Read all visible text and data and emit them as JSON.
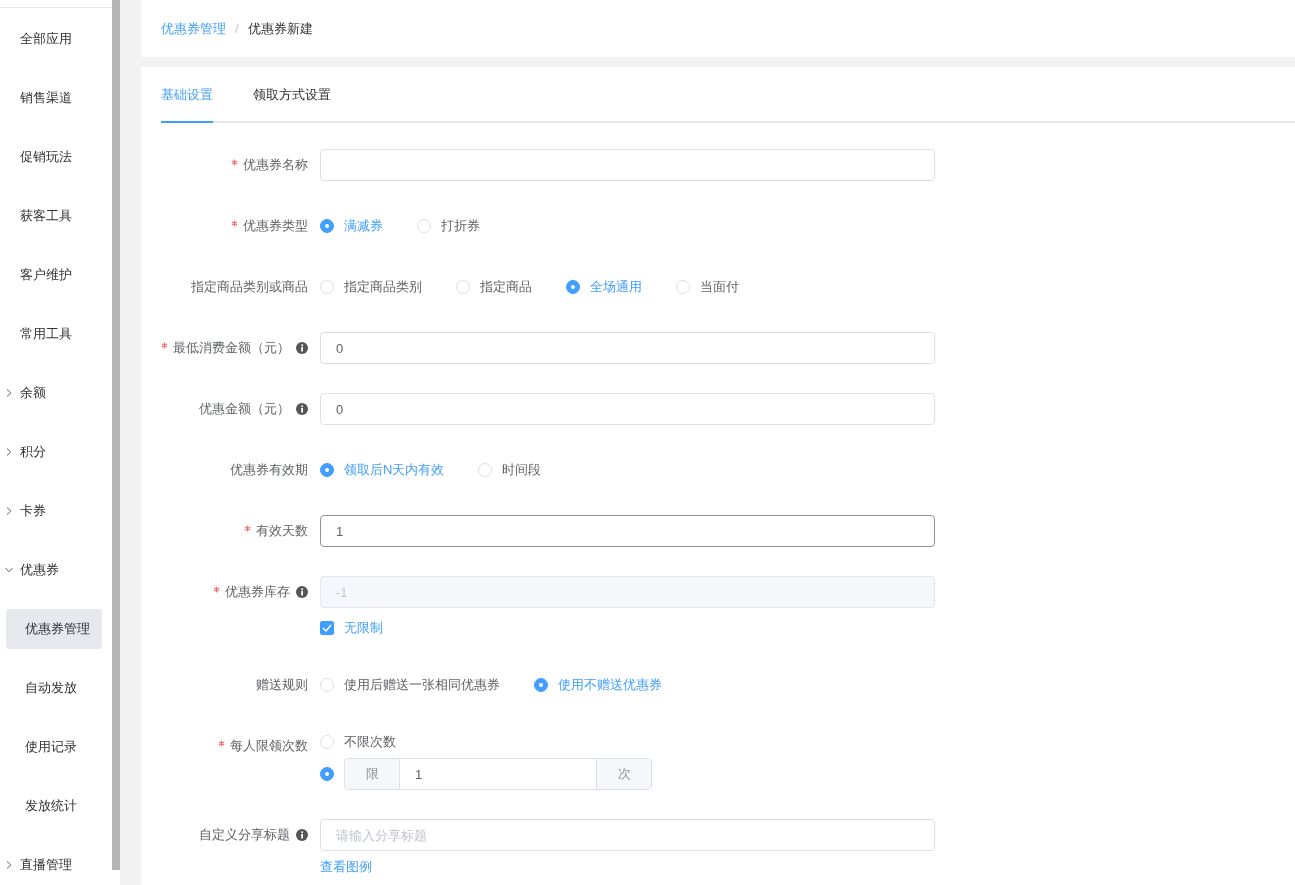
{
  "sidebar": {
    "items": [
      {
        "label": "全部应用",
        "kind": "plain"
      },
      {
        "label": "销售渠道",
        "kind": "plain"
      },
      {
        "label": "促销玩法",
        "kind": "plain"
      },
      {
        "label": "获客工具",
        "kind": "plain"
      },
      {
        "label": "客户维护",
        "kind": "plain"
      },
      {
        "label": "常用工具",
        "kind": "plain"
      },
      {
        "label": "余额",
        "kind": "group",
        "expanded": false
      },
      {
        "label": "积分",
        "kind": "group",
        "expanded": false
      },
      {
        "label": "卡券",
        "kind": "group",
        "expanded": false
      },
      {
        "label": "优惠券",
        "kind": "group",
        "expanded": true
      },
      {
        "label": "优惠券管理",
        "kind": "sub",
        "selected": true
      },
      {
        "label": "自动发放",
        "kind": "sub",
        "selected": false
      },
      {
        "label": "使用记录",
        "kind": "sub",
        "selected": false
      },
      {
        "label": "发放统计",
        "kind": "sub",
        "selected": false
      },
      {
        "label": "直播管理",
        "kind": "group",
        "expanded": false
      }
    ]
  },
  "breadcrumb": {
    "items": [
      "优惠券管理",
      "优惠券新建"
    ],
    "separator": "/"
  },
  "tabs": [
    {
      "label": "基础设置",
      "selected": true
    },
    {
      "label": "领取方式设置",
      "selected": false
    }
  ],
  "form": {
    "rows": [
      {
        "label": "优惠券名称",
        "required": true,
        "info": false,
        "kind": "input",
        "focused": false,
        "disabled": false
      },
      {
        "label": "优惠券类型",
        "required": true,
        "info": false,
        "kind": "radio",
        "options": [
          {
            "label": "满减券",
            "selected": true
          },
          {
            "label": "打折券",
            "selected": false
          }
        ]
      },
      {
        "label": "指定商品类别或商品",
        "required": false,
        "info": false,
        "kind": "radio",
        "options": [
          {
            "label": "指定商品类别",
            "selected": false
          },
          {
            "label": "指定商品",
            "selected": false
          },
          {
            "label": "全场通用",
            "selected": true
          },
          {
            "label": "当面付",
            "selected": false
          }
        ]
      },
      {
        "label": "最低消费金额（元）",
        "required": true,
        "info": true,
        "kind": "input",
        "value": "0",
        "focused": false,
        "disabled": false
      },
      {
        "label": "优惠金额（元）",
        "required": false,
        "info": true,
        "kind": "input",
        "value": "0",
        "focused": false,
        "disabled": false
      },
      {
        "label": "优惠券有效期",
        "required": false,
        "info": false,
        "kind": "radio",
        "options": [
          {
            "label": "领取后N天内有效",
            "selected": true
          },
          {
            "label": "时间段",
            "selected": false
          }
        ]
      },
      {
        "label": "有效天数",
        "required": true,
        "info": false,
        "kind": "input",
        "value": "1",
        "focused": true,
        "disabled": false
      },
      {
        "label": "优惠券库存",
        "required": true,
        "info": true,
        "kind": "input",
        "value": "-1",
        "focused": false,
        "disabled": true,
        "checkbox": {
          "label": "无限制",
          "checked": true
        }
      },
      {
        "label": "赠送规则",
        "required": false,
        "info": false,
        "kind": "radio",
        "options": [
          {
            "label": "使用后赠送一张相同优惠券",
            "selected": false
          },
          {
            "label": "使用不赠送优惠券",
            "selected": true
          }
        ]
      },
      {
        "label": "每人限领次数",
        "required": true,
        "info": false,
        "kind": "limit",
        "options": [
          {
            "label": "不限次数",
            "selected": false
          },
          {
            "prefix": "限",
            "value": "1",
            "suffix": "次",
            "selected": true
          }
        ]
      },
      {
        "label": "自定义分享标题",
        "required": false,
        "info": true,
        "kind": "input",
        "placeholder": "请输入分享标题",
        "focused": false,
        "disabled": false,
        "link": "查看图例"
      }
    ]
  }
}
